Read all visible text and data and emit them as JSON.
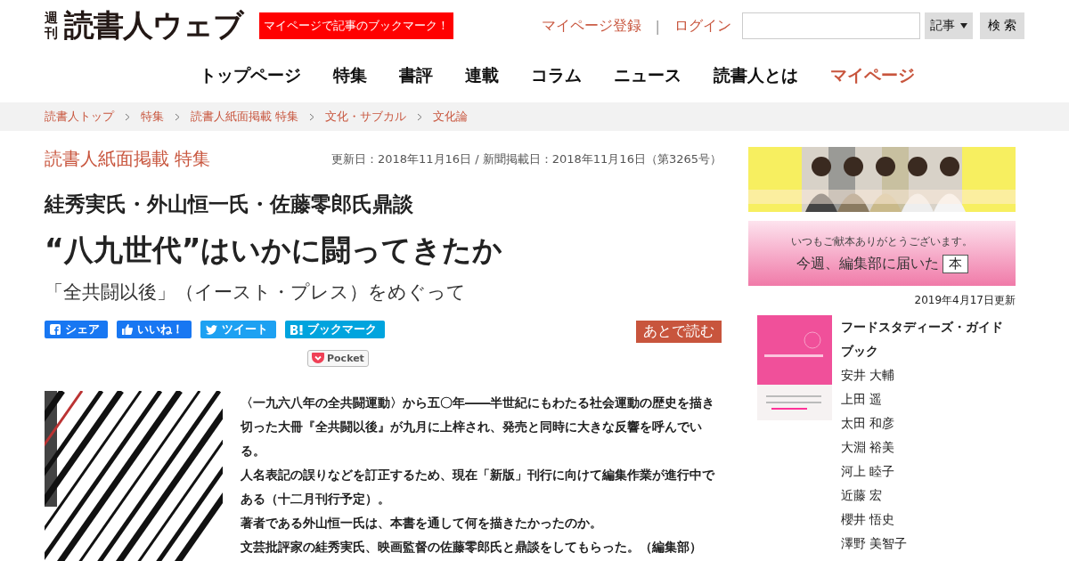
{
  "logo": {
    "small": "週刊",
    "main": "読書人ウェブ"
  },
  "promo_badge": "マイページで記事のブックマーク！",
  "top_links": [
    "マイページ登録",
    "ログイン"
  ],
  "link_separator": "|",
  "search": {
    "scope": "記事",
    "button": "検 索"
  },
  "nav": [
    {
      "label": "トップページ",
      "highlighted": false
    },
    {
      "label": "特集",
      "highlighted": false
    },
    {
      "label": "書評",
      "highlighted": false
    },
    {
      "label": "連載",
      "highlighted": false
    },
    {
      "label": "コラム",
      "highlighted": false
    },
    {
      "label": "ニュース",
      "highlighted": false
    },
    {
      "label": "読書人とは",
      "highlighted": false
    },
    {
      "label": "マイページ",
      "highlighted": true
    }
  ],
  "breadcrumbs": [
    "読書人トップ",
    "特集",
    "読書人紙面掲載 特集",
    "文化・サブカル",
    "文化論"
  ],
  "article": {
    "category": "読書人紙面掲載 特集",
    "dates": "更新日：2018年11月16日 / 新聞掲載日：2018年11月16日（第3265号）",
    "speakers": "絓秀実氏・外山恒一氏・佐藤零郎氏鼎談",
    "title": "“八九世代”はいかに闘ってきたか",
    "subtitle": "「全共闘以後」（イースト・プレス）をめぐって",
    "share": [
      {
        "kind": "facebook",
        "label": "シェア"
      },
      {
        "kind": "like",
        "label": "いいね！"
      },
      {
        "kind": "twitter",
        "label": "ツイート"
      },
      {
        "kind": "hatena",
        "label": "ブックマーク"
      }
    ],
    "pocket": "Pocket",
    "read_later": "あとで読む",
    "paragraphs": [
      "〈一九六八年の全共闘運動〉から五〇年――半世紀にもわたる社会運動の歴史を描き切った大冊『全共闘以後』が九月に上梓され、発売と同時に大きな反響を呼んでいる。",
      "人名表記の誤りなどを訂正するため、現在「新版」刊行に向けて編集作業が進行中である（十二月刊行予定）。",
      "著者である外山恒一氏は、本書を通して何を描きたかったのか。",
      "文芸批評家の絓秀実氏、映画監督の佐藤零郎氏と鼎談をしてもらった。（編集部）"
    ]
  },
  "sidebar": {
    "banner": {
      "tagline": "いつもご献本ありがとうございます。",
      "headline": "今週、編集部に届いた",
      "boxed": "本"
    },
    "updated": "2019年4月17日更新",
    "book": {
      "title": "フードスタディーズ・ガイドブック",
      "authors": [
        "安井 大輔",
        "上田 遥",
        "太田 和彦",
        "大淵 裕美",
        "河上 睦子",
        "近藤 宏",
        "櫻井 悟史",
        "澤野 美智子"
      ]
    }
  }
}
